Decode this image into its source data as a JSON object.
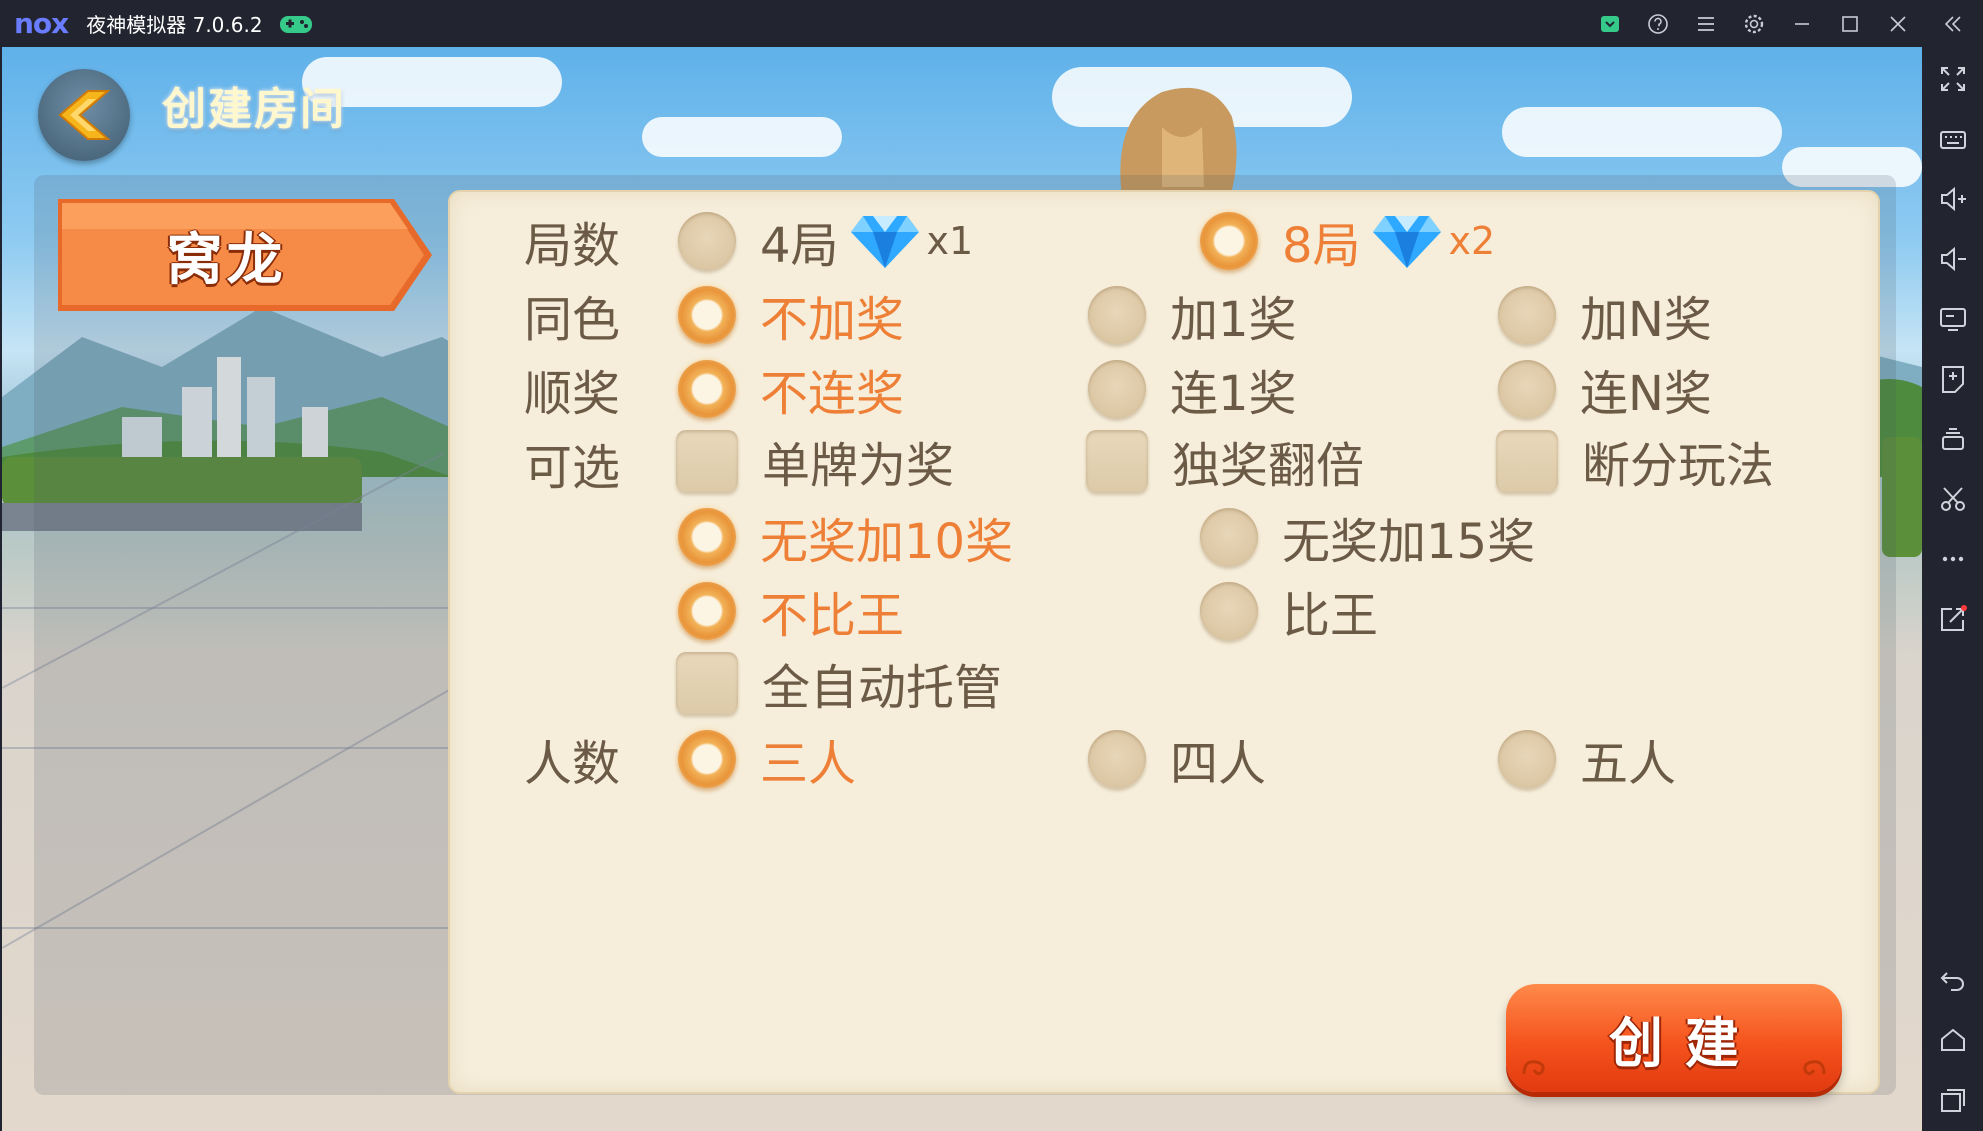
{
  "window": {
    "logo_text": "nox",
    "title": "夜神模拟器 7.0.6.2",
    "icons": [
      "gamepad-icon",
      "share-icon",
      "help-icon",
      "menu-icon",
      "settings-icon",
      "minimize-icon",
      "maximize-icon",
      "close-icon",
      "collapse-icon"
    ]
  },
  "sidebar": {
    "icons": [
      "fullscreen-icon",
      "keyboard-icon",
      "volume-up-icon",
      "volume-down-icon",
      "screen-icon",
      "apk-install-icon",
      "multi-instance-icon",
      "screenshot-scissors-icon",
      "more-icon",
      "share-out-icon",
      "back-icon",
      "home-icon",
      "recent-apps-icon"
    ]
  },
  "game": {
    "title": "创建房间",
    "tab_label": "窝龙",
    "rows": {
      "rounds": {
        "label": "局数",
        "options": [
          {
            "label": "4局",
            "mult": "x1",
            "selected": false
          },
          {
            "label": "8局",
            "mult": "x2",
            "selected": true
          }
        ]
      },
      "same_color": {
        "label": "同色",
        "options": [
          {
            "label": "不加奖",
            "selected": true
          },
          {
            "label": "加1奖",
            "selected": false
          },
          {
            "label": "加N奖",
            "selected": false
          }
        ]
      },
      "straight": {
        "label": "顺奖",
        "options": [
          {
            "label": "不连奖",
            "selected": true
          },
          {
            "label": "连1奖",
            "selected": false
          },
          {
            "label": "连N奖",
            "selected": false
          }
        ]
      },
      "optional": {
        "label": "可选",
        "checks": [
          {
            "label": "单牌为奖",
            "checked": false
          },
          {
            "label": "独奖翻倍",
            "checked": false
          },
          {
            "label": "断分玩法",
            "checked": false
          }
        ],
        "bonus": [
          {
            "label": "无奖加10奖",
            "selected": true
          },
          {
            "label": "无奖加15奖",
            "selected": false
          }
        ],
        "king": [
          {
            "label": "不比王",
            "selected": true
          },
          {
            "label": "比王",
            "selected": false
          }
        ],
        "auto": {
          "label": "全自动托管",
          "checked": false
        }
      },
      "players": {
        "label": "人数",
        "options": [
          {
            "label": "三人",
            "selected": true
          },
          {
            "label": "四人",
            "selected": false
          },
          {
            "label": "五人",
            "selected": false
          }
        ]
      }
    },
    "create_label": "创建",
    "colors": {
      "accent": "#ee7f36",
      "text": "#6b5a46",
      "panel": "#f6eedb",
      "button": "#f5531d"
    }
  }
}
